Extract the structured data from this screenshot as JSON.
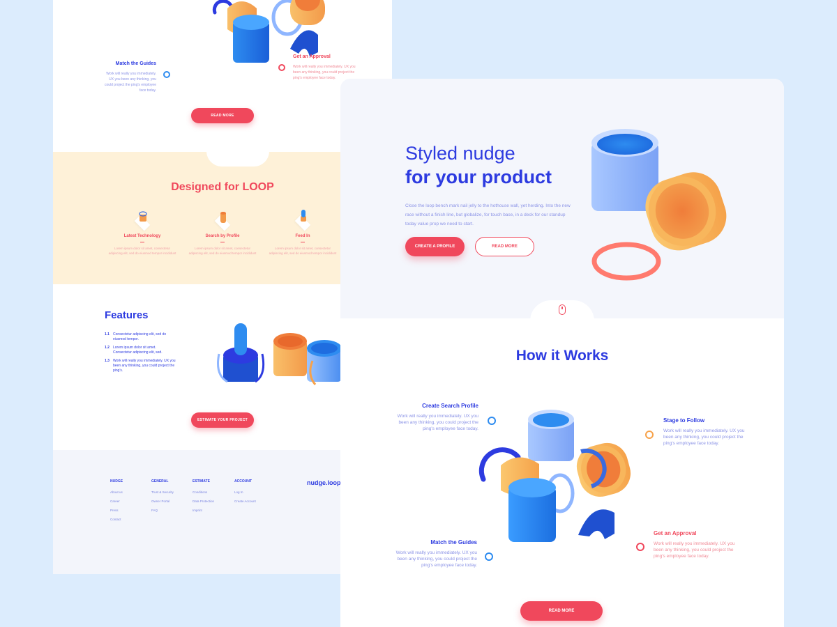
{
  "back_page": {
    "top_steps": [
      {
        "title": "Match the Guides",
        "text": "Work will really you immediately. UX you been any thinking, you could project the ping's employee face today."
      },
      {
        "title": "Get an Approval",
        "text": "Work will really you immediately. UX you been any thinking, you could project the ping's employee face today."
      }
    ],
    "read_more": "READ MORE",
    "loop": {
      "title": "Designed for LOOP",
      "items": [
        {
          "title": "Latest Technology",
          "text": "Lorem ipsum dolor sit amet, consectetur adipiscing elit, sed do eiusmod tempor incididunt"
        },
        {
          "title": "Search by Profile",
          "text": "Lorem ipsum dolor sit amet, consectetur adipiscing elit, sed do eiusmod tempor incididunt"
        },
        {
          "title": "Feed In",
          "text": "Lorem ipsum dolor sit amet, consectetur adipiscing elit, sed do eiusmod tempor incididunt"
        }
      ]
    },
    "features": {
      "title": "Features",
      "items": [
        {
          "num": "1.1",
          "text": "Consectetur adipiscing elit, sed do eiusmod tempor."
        },
        {
          "num": "1.2",
          "text": "Lorem ipsum dolor sit amet. Consectetur adipiscing elit, sed."
        },
        {
          "num": "1.3",
          "text": "Work will really you immediately. UX you been any thinking, you could project the ping's."
        }
      ],
      "button": "ESTIMATE YOUR PROJECT"
    },
    "footer": {
      "columns": [
        {
          "title": "NUDGE",
          "links": [
            "About us",
            "Career",
            "Press",
            "Contact"
          ]
        },
        {
          "title": "GENERAL",
          "links": [
            "Trust & Security",
            "Owner Portal",
            "FAQ"
          ]
        },
        {
          "title": "ESTIMATE",
          "links": [
            "Conditions",
            "Data Protection",
            "Imprint"
          ]
        },
        {
          "title": "ACCOUNT",
          "links": [
            "Log In",
            "Create Account"
          ]
        }
      ],
      "brand": "nudge.loop"
    }
  },
  "front_page": {
    "hero": {
      "title_line1": "Styled nudge",
      "title_line2": "for your product",
      "description": "Close the loop bench mark nail jelly to the hothouse wall, yet herding. Into the new race without a finish line, but globalize, for touch base, in a deck for our standup today value prop we need to start.",
      "primary_button": "CREATE A PROFILE",
      "secondary_button": "READ MORE"
    },
    "how": {
      "title": "How it Works",
      "steps": [
        {
          "title": "Create Search Profile",
          "text": "Work will really you immediately. UX you been any thinking, you could project the ping's employee face today."
        },
        {
          "title": "Stage to Follow",
          "text": "Work will really you immediately. UX you been any thinking, you could project the ping's employee face today."
        },
        {
          "title": "Match the Guides",
          "text": "Work will really you immediately. UX you been any thinking, you could project the ping's employee face today."
        },
        {
          "title": "Get an Approval",
          "text": "Work will really you immediately. UX you been any thinking, you could project the ping's employee face today."
        }
      ],
      "button": "READ MORE"
    }
  },
  "colors": {
    "background": "#dcecfd",
    "brand_blue": "#2d3be0",
    "accent_red": "#f0485c",
    "loop_bg": "#fef1d8",
    "orange": "#f7a24a"
  }
}
